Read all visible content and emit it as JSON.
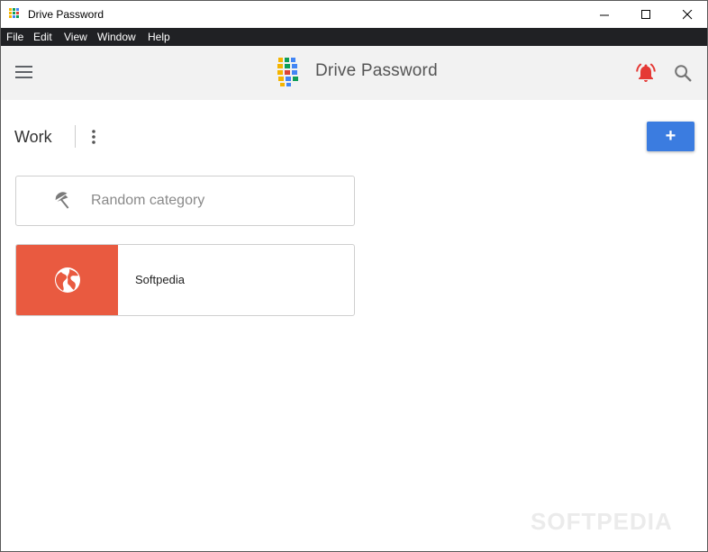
{
  "window": {
    "title": "Drive Password",
    "controls": [
      "minimize-icon",
      "maximize-icon",
      "close-icon"
    ]
  },
  "menubar": {
    "items": [
      "File",
      "Edit",
      "View",
      "Window",
      "Help"
    ]
  },
  "appbar": {
    "title": "Drive Password",
    "icons": [
      "menu-icon",
      "logo",
      "bell-icon",
      "search-icon"
    ],
    "bell_color": "#e53935"
  },
  "category": {
    "title": "Work",
    "add_label": "+",
    "accent_color": "#3b7ce0"
  },
  "random_card": {
    "label": "Random category",
    "icon": "umbrella-icon"
  },
  "entries": [
    {
      "label": "Softpedia",
      "icon": "globe-icon",
      "color": "#e95a40"
    }
  ],
  "watermark": "SOFTPEDIA"
}
